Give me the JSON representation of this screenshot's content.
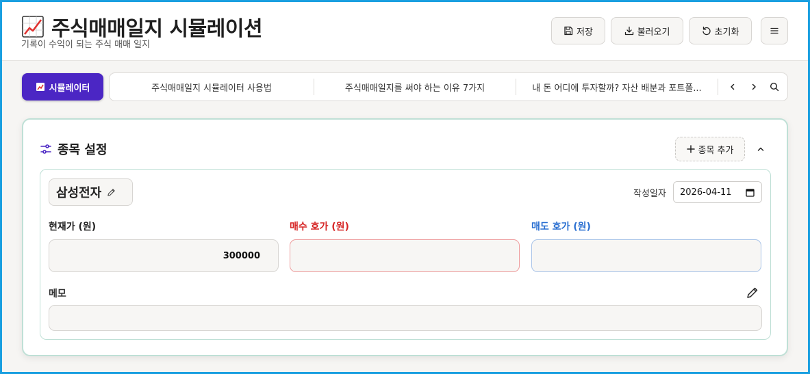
{
  "header": {
    "title": "주식매매일지 시뮬레이션",
    "subtitle": "기록이 수익이 되는 주식 매매 일지",
    "save_label": "저장",
    "load_label": "불러오기",
    "reset_label": "초기화"
  },
  "nav": {
    "simulator_label": "시뮬레이터",
    "links": [
      "주식매매일지 시뮬레이터 사용법",
      "주식매매일지를 써야 하는 이유 7가지",
      "내 돈 어디에 투자할까? 자산 배분과 포트폴..."
    ]
  },
  "stock_settings": {
    "title": "종목 설정",
    "add_label": "종목 추가",
    "stock": {
      "name": "삼성전자",
      "date_label": "작성일자",
      "date_value": "2026-04-11",
      "current_price_label": "현재가 (원)",
      "current_price_value": "300000",
      "buy_price_label": "매수 호가 (원)",
      "buy_price_value": "",
      "sell_price_label": "매도 호가 (원)",
      "sell_price_value": "",
      "memo_label": "메모",
      "memo_value": ""
    }
  },
  "colors": {
    "accent": "#4b26c4",
    "buy": "#d62424",
    "sell": "#2a6fd1",
    "panel_border": "#bfe0d6"
  },
  "icons": {
    "title": "chart-increasing-icon",
    "save": "floppy-disk-icon",
    "load": "download-icon",
    "reset": "rotate-left-icon",
    "menu": "hamburger-menu-icon",
    "settings": "sliders-icon",
    "add": "plus-icon",
    "collapse": "chevron-up-icon",
    "edit": "pencil-icon",
    "calendar": "calendar-icon",
    "prev": "chevron-left-icon",
    "next": "chevron-right-icon",
    "search": "search-icon"
  }
}
